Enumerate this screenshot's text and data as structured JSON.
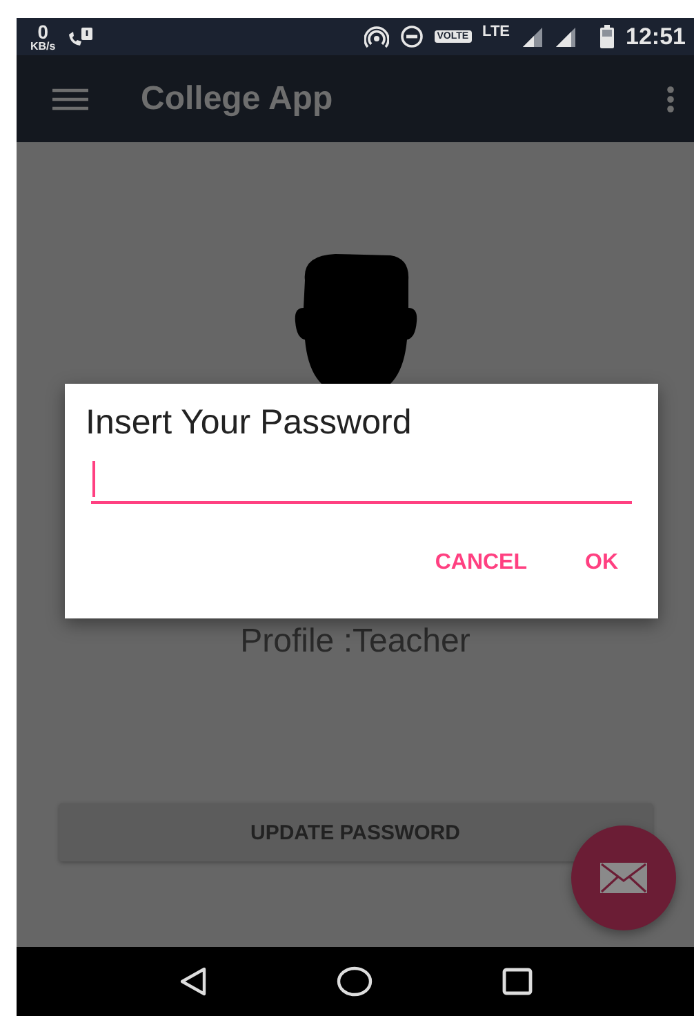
{
  "status_bar": {
    "speed_value": "0",
    "speed_unit": "KB/s",
    "volte": "VOLTE",
    "network": "LTE",
    "time": "12:51"
  },
  "toolbar": {
    "title": "College App"
  },
  "profile": {
    "label": "Profile :Teacher"
  },
  "update_button": {
    "label": "UPDATE PASSWORD"
  },
  "dialog": {
    "title": "Insert Your Password",
    "field": {
      "focused": true
    },
    "buttons": [
      "CANCEL",
      "OK"
    ]
  }
}
